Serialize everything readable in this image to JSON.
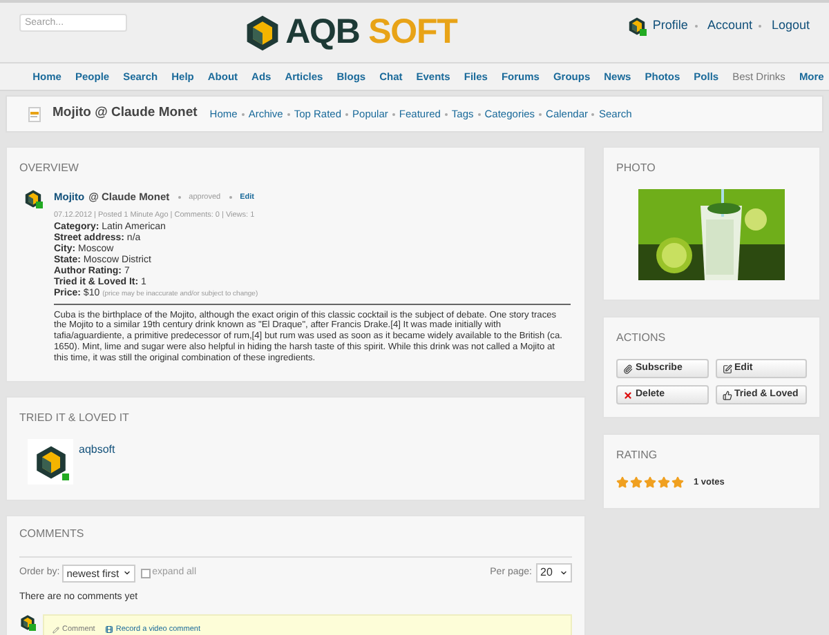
{
  "header": {
    "search": {
      "placeholder": "Search..."
    },
    "logo": {
      "part1": "AQB",
      "part2": "SOFT"
    },
    "user_links": [
      "Profile",
      "Account",
      "Logout"
    ]
  },
  "nav": [
    {
      "label": "Home",
      "selected": false
    },
    {
      "label": "People",
      "selected": false
    },
    {
      "label": "Search",
      "selected": false
    },
    {
      "label": "Help",
      "selected": false
    },
    {
      "label": "About",
      "selected": false
    },
    {
      "label": "Ads",
      "selected": false
    },
    {
      "label": "Articles",
      "selected": false
    },
    {
      "label": "Blogs",
      "selected": false
    },
    {
      "label": "Chat",
      "selected": false
    },
    {
      "label": "Events",
      "selected": false
    },
    {
      "label": "Files",
      "selected": false
    },
    {
      "label": "Forums",
      "selected": false
    },
    {
      "label": "Groups",
      "selected": false
    },
    {
      "label": "News",
      "selected": false
    },
    {
      "label": "Photos",
      "selected": false
    },
    {
      "label": "Polls",
      "selected": false
    },
    {
      "label": "Best Drinks",
      "selected": true
    },
    {
      "label": "More",
      "selected": false
    }
  ],
  "subheader": {
    "title": "Mojito @ Claude Monet",
    "links": [
      "Home",
      "Archive",
      "Top Rated",
      "Popular",
      "Featured",
      "Tags",
      "Categories",
      "Calendar",
      "Search"
    ]
  },
  "overview": {
    "heading": "OVERVIEW",
    "title_link": "Mojito",
    "title_rest": "@ Claude Monet",
    "status": "approved",
    "edit": "Edit",
    "meta": "07.12.2012 | Posted 1 Minute Ago | Comments: 0 | Views: 1",
    "fields": [
      {
        "label": "Category:",
        "value": "Latin American"
      },
      {
        "label": "Street address:",
        "value": "n/a"
      },
      {
        "label": "City:",
        "value": "Moscow"
      },
      {
        "label": "State:",
        "value": "Moscow District"
      },
      {
        "label": "Author Rating:",
        "value": "7"
      },
      {
        "label": "Tried it & Loved It:",
        "value": "1"
      },
      {
        "label": "Price:",
        "value": "$10",
        "note": "(price may be inaccurate and/or subject to change)"
      }
    ],
    "description": "Cuba is the birthplace of the Mojito, although the exact origin of this classic cocktail is the subject of debate. One story traces the Mojito to a similar 19th century drink known as \"El Draque\", after Francis Drake.[4] It was made initially with tafia/aguardiente, a primitive predecessor of rum,[4] but rum was used as soon as it became widely available to the British (ca. 1650). Mint, lime and sugar were also helpful in hiding the harsh taste of this spirit. While this drink was not called a Mojito at this time, it was still the original combination of these ingredients."
  },
  "tried": {
    "heading": "TRIED IT & LOVED IT",
    "users": [
      {
        "name": "aqbsoft",
        "online": true
      }
    ]
  },
  "comments": {
    "heading": "COMMENTS",
    "order_label": "Order by:",
    "order_value": "newest first",
    "expand": {
      "label": "expand all",
      "checked": false
    },
    "per_page_label": "Per page:",
    "per_page_value": "20",
    "empty": "There are no comments yet",
    "comment_link": "Comment",
    "video_link": "Record a video comment"
  },
  "photo": {
    "heading": "PHOTO"
  },
  "actions": {
    "heading": "ACTIONS",
    "buttons": [
      {
        "kind": "subscribe",
        "label": "Subscribe"
      },
      {
        "kind": "edit",
        "label": "Edit"
      },
      {
        "kind": "delete",
        "label": "Delete"
      },
      {
        "kind": "like",
        "label": "Tried & Loved"
      }
    ]
  },
  "rating": {
    "heading": "RATING",
    "stars": 5,
    "votes": "1 votes"
  }
}
